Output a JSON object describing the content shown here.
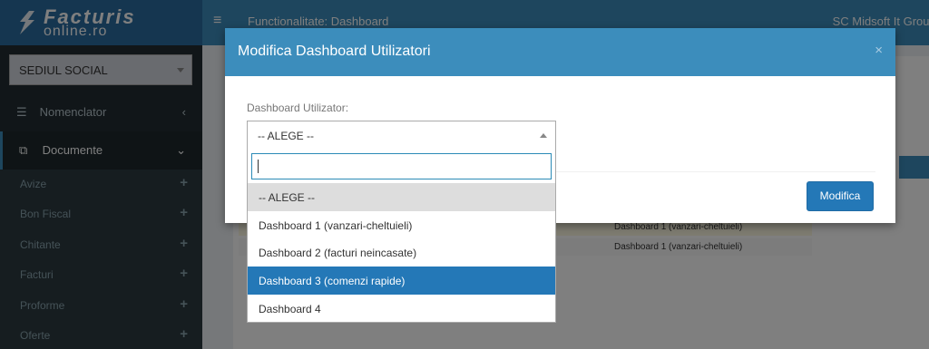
{
  "logo": {
    "line1": "Facturis",
    "line2": "online.ro"
  },
  "header": {
    "menu_icon": "hamburger-icon",
    "page_title": "Functionalitate: Dashboard",
    "company": "SC Midsoft It Group S"
  },
  "sidebar": {
    "location_select": "SEDIUL SOCIAL",
    "nomenclator": "Nomenclator",
    "documente": "Documente",
    "sub_items": [
      "Avize",
      "Bon Fiscal",
      "Chitante",
      "Facturi",
      "Proforme",
      "Oferte"
    ]
  },
  "background": {
    "row1_value": "Dashboard 1 (vanzari-cheltuieli)",
    "row2_value": "Dashboard 1 (vanzari-cheltuieli)"
  },
  "modal": {
    "title": "Modifica Dashboard Utilizatori",
    "close": "×",
    "field_label": "Dashboard Utilizator:",
    "selected_value": "-- ALEGE --",
    "search_value": "",
    "options": [
      "-- ALEGE --",
      "Dashboard 1 (vanzari-cheltuieli)",
      "Dashboard 2 (facturi neincasate)",
      "Dashboard 3 (comenzi rapide)",
      "Dashboard 4"
    ],
    "highlighted_option": "Dashboard 3 (comenzi rapide)",
    "submit_label": "Modifica"
  },
  "colors": {
    "header": "#3c8dbc",
    "logo_bg": "#2a6da0",
    "sidebar": "#222d32",
    "button": "#2478b7"
  }
}
